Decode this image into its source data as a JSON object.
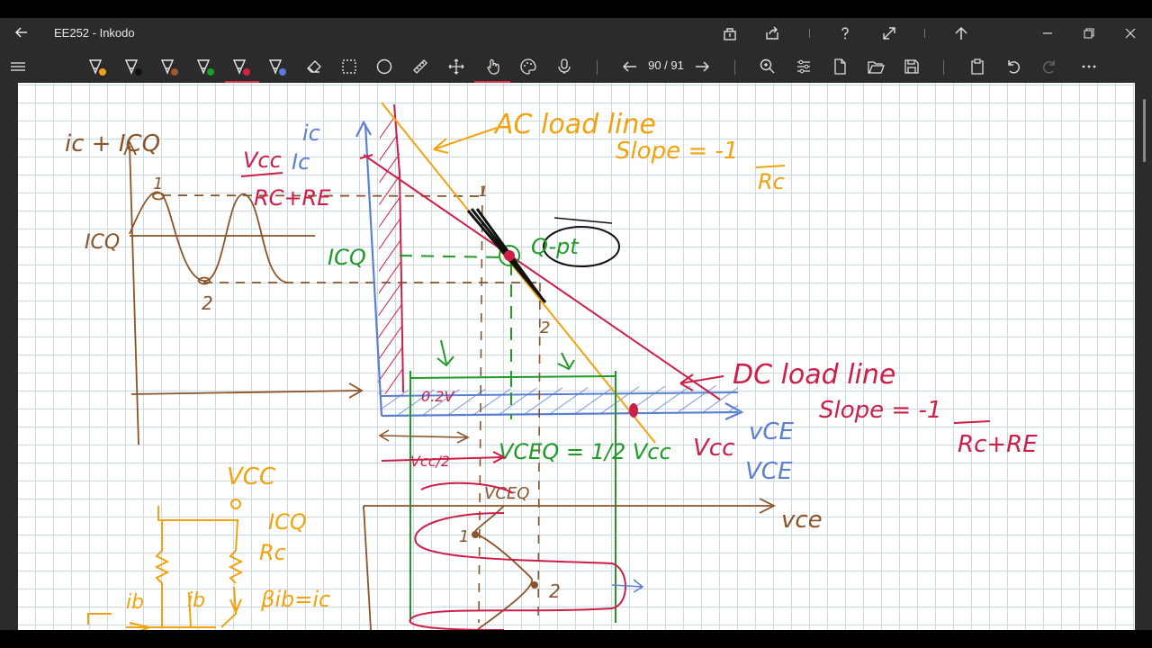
{
  "window": {
    "title": "EE252 - Inkodo"
  },
  "toolbar": {
    "page_counter": "90 / 91",
    "pens": [
      {
        "name": "pen-orange",
        "color": "#f0a020"
      },
      {
        "name": "pen-black",
        "color": "#111111"
      },
      {
        "name": "pen-brown",
        "color": "#9a5a2a"
      },
      {
        "name": "pen-green",
        "color": "#1a9a2a"
      },
      {
        "name": "pen-red",
        "color": "#d62040"
      },
      {
        "name": "pen-blue",
        "color": "#5a7ad8"
      }
    ],
    "active_tool": "pen-red",
    "accent": "#d9364e"
  },
  "colors": {
    "orange": "#f2a20c",
    "brown": "#8a5428",
    "green": "#1f9a24",
    "crimson": "#cc1f47",
    "blue": "#5b7fd1",
    "black": "#111111",
    "grid": "#c9d7e6"
  },
  "notes": {
    "ac_load_line": "AC load line",
    "ac_slope": "Slope = -1",
    "ac_slope_den": "Rc",
    "dc_load_line": "DC load line",
    "dc_slope": "Slope = -1",
    "dc_slope_den": "Rc+RE",
    "q_point": "Q-pt",
    "ic_axis": "ic",
    "ic_axis2": "Ic",
    "left_axis": "ic + ICQ",
    "icq_left": "ICQ",
    "icq_green": "ICQ",
    "vcc_over": "Vcc",
    "vcc_den": "RC+RE",
    "vce_small": "vCE",
    "vce_big": "VCE",
    "vcc_red": "Vcc",
    "vceq_eq": "VCEQ = 1/2 Vcc",
    "vcc_half": "Vcc/2",
    "vceq_small": "VCEQ",
    "sat_v": "0.2V",
    "vce_brown": "vce",
    "point1": "1",
    "point2": "2",
    "circuit_vcc": "VCC",
    "circuit_icq": "ICQ",
    "circuit_rc": "Rc",
    "circuit_beta": "βib=ic",
    "circuit_ib1": "ib",
    "circuit_ib2": "ib"
  }
}
